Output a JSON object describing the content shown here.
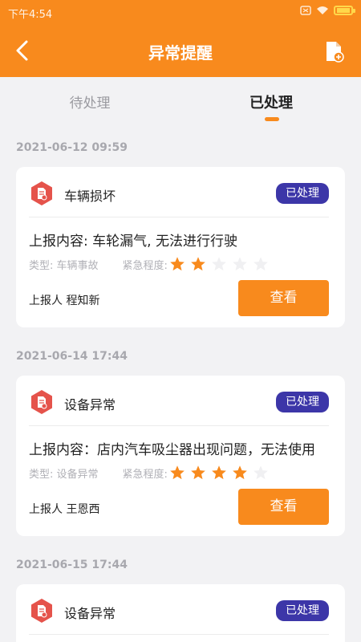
{
  "status_bar": {
    "time": "下午4:54"
  },
  "header": {
    "title": "异常提醒"
  },
  "tabs": [
    {
      "label": "待处理",
      "active": false
    },
    {
      "label": "已处理",
      "active": true
    }
  ],
  "colors": {
    "accent": "#f88a1d",
    "badge": "#3c36a8",
    "icon_red": "#e5534b"
  },
  "records": [
    {
      "date": "2021-06-12 09:59",
      "category": "车辆损坏",
      "status": "已处理",
      "content": "上报内容: 车轮漏气, 无法进行行驶",
      "type_text": "类型: 车辆事故",
      "urgency_label": "紧急程度:",
      "urgency_stars": 2,
      "max_stars": 5,
      "reporter": "上报人 程知新",
      "view_label": "查看"
    },
    {
      "date": "2021-06-14 17:44",
      "category": "设备异常",
      "status": "已处理",
      "content": "上报内容：店内汽车吸尘器出现问题，无法使用",
      "type_text": "类型: 设备异常",
      "urgency_label": "紧急程度:",
      "urgency_stars": 4,
      "max_stars": 5,
      "reporter": "上报人 王恩西",
      "view_label": "查看"
    },
    {
      "date": "2021-06-15 17:44",
      "category": "设备异常",
      "status": "已处理"
    }
  ]
}
